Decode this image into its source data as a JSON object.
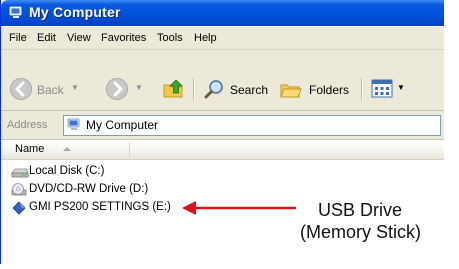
{
  "window": {
    "title": "My Computer"
  },
  "menu": [
    "File",
    "Edit",
    "View",
    "Favorites",
    "Tools",
    "Help"
  ],
  "toolbar": {
    "back_label": "Back",
    "search_label": "Search",
    "folders_label": "Folders"
  },
  "address": {
    "label": "Address",
    "value": "My Computer"
  },
  "columns": {
    "name": "Name"
  },
  "items": [
    {
      "label": "Local Disk (C:)",
      "icon": "hard-disk-icon"
    },
    {
      "label": "DVD/CD-RW Drive (D:)",
      "icon": "dvd-drive-icon"
    },
    {
      "label": "GMI PS200 SETTINGS (E:)",
      "icon": "usb-drive-icon"
    }
  ],
  "annotation": {
    "line1": "USB Drive",
    "line2": "(Memory Stick)",
    "arrow_color": "#e0101a"
  },
  "colors": {
    "titlebar": "#0353d8",
    "chrome": "#ece9d8"
  }
}
